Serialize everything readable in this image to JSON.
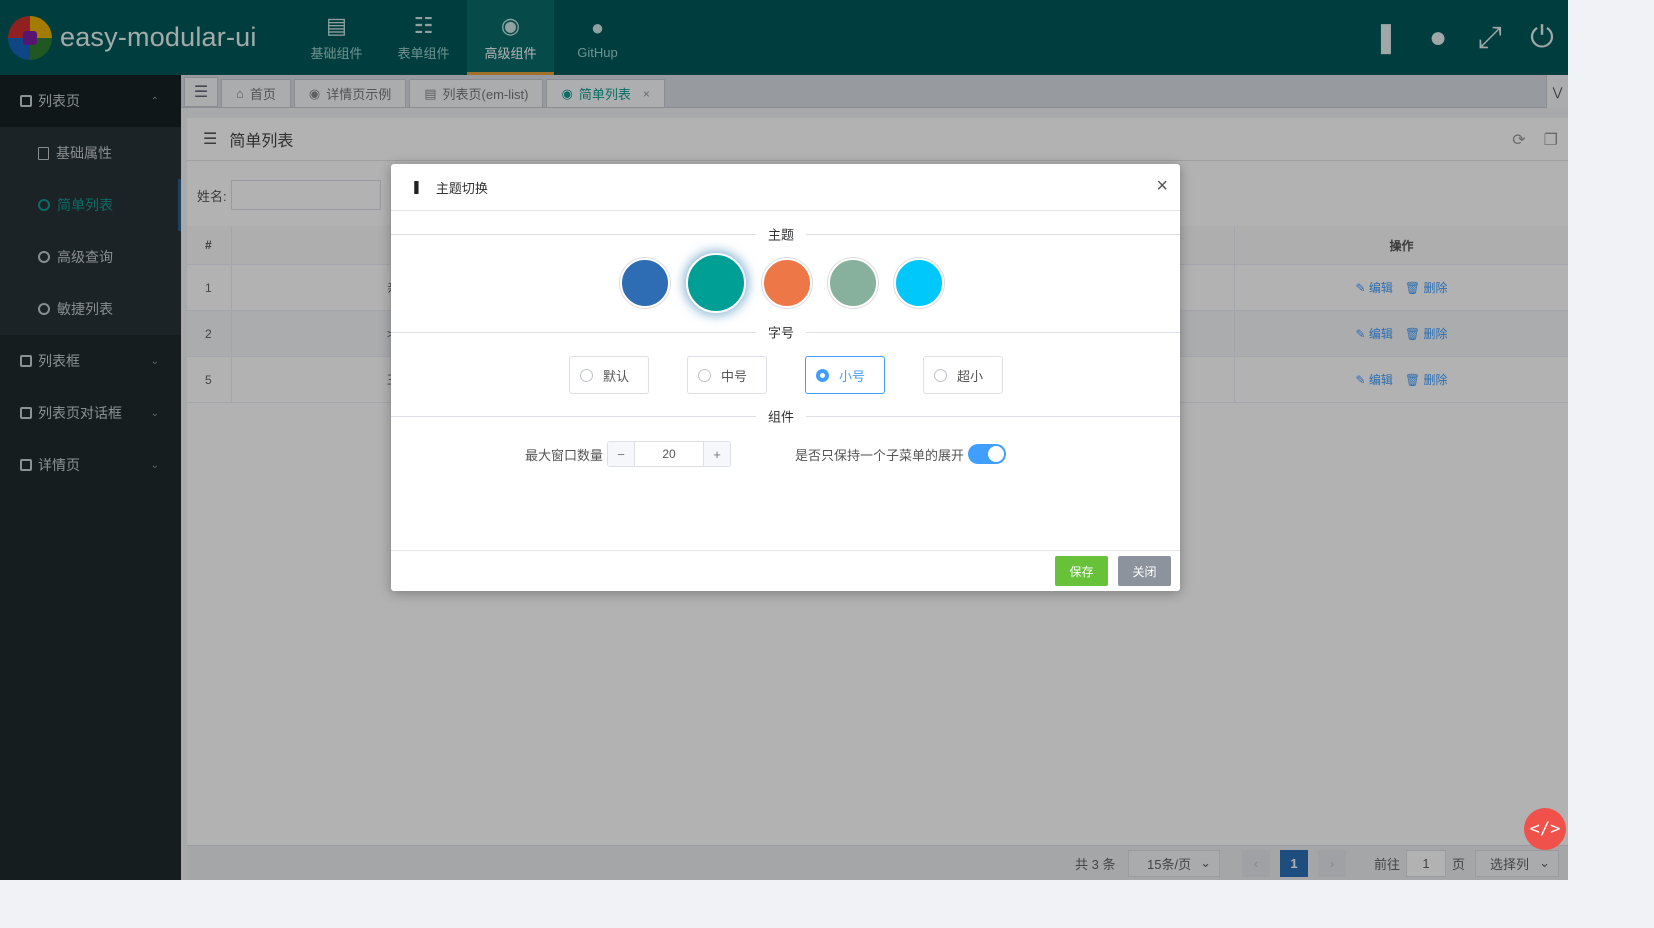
{
  "app": {
    "title": "easy-modular-ui"
  },
  "top_nav": [
    {
      "label": "基础组件",
      "icon": "layers-icon"
    },
    {
      "label": "表单组件",
      "icon": "form-icon"
    },
    {
      "label": "高级组件",
      "icon": "chrome-icon",
      "active": true
    },
    {
      "label": "GitHup",
      "icon": "github-icon"
    }
  ],
  "header_actions": [
    "shirt-icon",
    "user-icon",
    "fullscreen-icon",
    "power-icon"
  ],
  "sidebar": {
    "groups": [
      {
        "label": "列表页",
        "open": true,
        "items": [
          {
            "label": "基础属性"
          },
          {
            "label": "简单列表",
            "active": true
          },
          {
            "label": "高级查询"
          },
          {
            "label": "敏捷列表"
          }
        ]
      },
      {
        "label": "列表框"
      },
      {
        "label": "列表页对话框"
      },
      {
        "label": "详情页"
      }
    ]
  },
  "tabs": [
    {
      "label": "首页",
      "icon": "home-icon"
    },
    {
      "label": "详情页示例",
      "icon": "chrome-icon"
    },
    {
      "label": "列表页(em-list)",
      "icon": "list-icon"
    },
    {
      "label": "简单列表",
      "icon": "chrome-icon",
      "active": true,
      "close": "×"
    }
  ],
  "panel": {
    "title": "简单列表"
  },
  "filter": {
    "name_label": "姓名:"
  },
  "table": {
    "headers": {
      "index": "#",
      "op": "操作"
    },
    "rows": [
      {
        "index": "1",
        "partial": "亲"
      },
      {
        "index": "2",
        "partial": ">"
      },
      {
        "index": "5",
        "partial": "王"
      }
    ],
    "edit_label": "编辑",
    "delete_label": "删除"
  },
  "pager": {
    "total": "共 3 条",
    "page_size": "15条/页",
    "current": "1",
    "goto_prefix": "前往",
    "goto_value": "1",
    "goto_suffix": "页",
    "columns": "选择列"
  },
  "dialog": {
    "title": "主题切换",
    "close": "×",
    "section_theme": "主题",
    "swatches": [
      "#2e6db4",
      "#009f95",
      "#ee7748",
      "#87b19d",
      "#00c8fb"
    ],
    "selected_swatch": 1,
    "section_font": "字号",
    "font_sizes": [
      "默认",
      "中号",
      "小号",
      "超小"
    ],
    "selected_font": 2,
    "section_component": "组件",
    "max_windows_label": "最大窗口数量",
    "max_windows_value": "20",
    "stepper_minus": "−",
    "stepper_plus": "+",
    "single_submenu_label": "是否只保持一个子菜单的展开",
    "single_submenu_on": true,
    "save_label": "保存",
    "close_label": "关闭"
  },
  "fab": {
    "label": "</>"
  }
}
